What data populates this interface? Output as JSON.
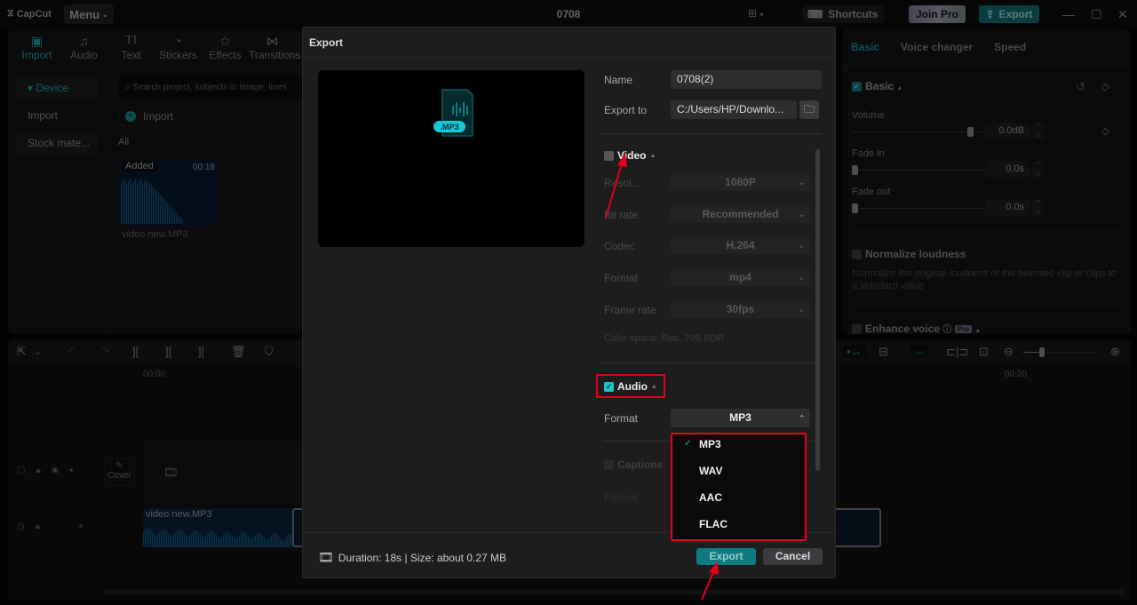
{
  "app": {
    "logo": "CapCut",
    "menu_label": "Menu",
    "project_title": "0708",
    "shortcuts_label": "Shortcuts",
    "join_pro_label": "Join Pro",
    "export_label": "Export"
  },
  "left_panel": {
    "tool_tabs": [
      {
        "label": "Import",
        "icon": "import-icon",
        "active": true
      },
      {
        "label": "Audio",
        "icon": "audio-icon"
      },
      {
        "label": "Text",
        "icon": "text-icon"
      },
      {
        "label": "Stickers",
        "icon": "stickers-icon"
      },
      {
        "label": "Effects",
        "icon": "effects-icon"
      },
      {
        "label": "Transitions",
        "icon": "transitions-icon"
      }
    ],
    "side_nav": [
      {
        "label": "▾ Device",
        "active": true
      },
      {
        "label": "Import"
      },
      {
        "label": "Stock mate..."
      }
    ],
    "search_placeholder": "Search project, subjects in image, lines",
    "import_button": "Import",
    "all_label": "All",
    "media": {
      "badge": "Added",
      "duration": "00:18",
      "name": "video new.MP3"
    }
  },
  "right_panel": {
    "tabs": [
      "Basic",
      "Voice changer",
      "Speed"
    ],
    "basic_section": "Basic",
    "volume_label": "Volume",
    "volume_value": "0.0dB",
    "volume_level": 0.74,
    "fade_in_label": "Fade in",
    "fade_in_value": "0.0s",
    "fade_in_level": 0,
    "fade_out_label": "Fade out",
    "fade_out_value": "0.0s",
    "fade_out_level": 0,
    "normalize_label": "Normalize loudness",
    "normalize_desc": "Normalize the original loudness of the selected clip or clips to a standard value",
    "enhance_label": "Enhance voice",
    "pro_badge": "Pro"
  },
  "timeline": {
    "time_start": "00:00",
    "time_mark": "00:20",
    "cover_label": "Cover",
    "audio_clip_name": "video new.MP3"
  },
  "export_dialog": {
    "title": "Export",
    "preview_badge": ".MP3",
    "name_label": "Name",
    "name_value": "0708(2)",
    "export_to_label": "Export to",
    "export_to_value": "C:/Users/HP/Downlo...",
    "video": {
      "label": "Video",
      "checked": false,
      "rows": [
        {
          "label": "Resol...",
          "value": "1080P"
        },
        {
          "label": "Bit rate",
          "value": "Recommended"
        },
        {
          "label": "Codec",
          "value": "H.264"
        },
        {
          "label": "Format",
          "value": "mp4"
        },
        {
          "label": "Frame rate",
          "value": "30fps"
        }
      ],
      "color_space": "Color space: Rec. 709 SDR"
    },
    "audio": {
      "label": "Audio",
      "checked": true,
      "format_label": "Format",
      "format_value": "MP3",
      "format_options": [
        "MP3",
        "WAV",
        "AAC",
        "FLAC"
      ],
      "selected_option": "MP3"
    },
    "captions": {
      "label": "Captions",
      "format_label": "Format"
    },
    "info": "Duration: 18s | Size: about 0.27 MB",
    "export_button": "Export",
    "cancel_button": "Cancel"
  },
  "colors": {
    "accent": "#1a8d93",
    "annotation_red": "#e2001a",
    "checkbox_on": "#1ec4d2"
  }
}
